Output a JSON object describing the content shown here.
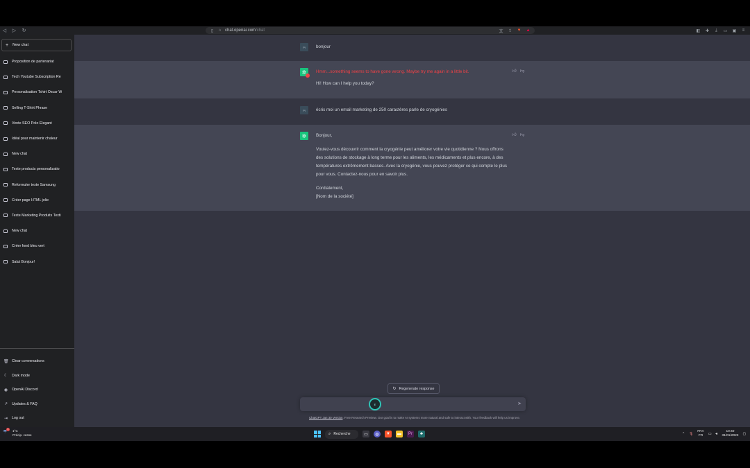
{
  "browser": {
    "url_host": "chat.openai.com",
    "url_path": "/chat"
  },
  "sidebar": {
    "new_chat_label": "New chat",
    "conversations": [
      "Proposition de partenariat",
      "Tech Youtube Subscription Re",
      "Personalisation Tshirt Oscar W",
      "Selling T-Shirt Phrase",
      "Vente SEO Polo Elegant",
      "Idéal pour maintenir chaleur",
      "New chat",
      "Texte products personalizatio",
      "Reformuler texte Samsung",
      "Créer page HTML jolie",
      "Texte Marketing Produits Texti",
      "New chat",
      "Créer fond bleu vert",
      "Salut Bonjour!"
    ],
    "actions": [
      {
        "label": "Clear conversations",
        "icon": "trash-icon"
      },
      {
        "label": "Dark mode",
        "icon": "moon-icon"
      },
      {
        "label": "OpenAI Discord",
        "icon": "discord-icon"
      },
      {
        "label": "Updates & FAQ",
        "icon": "external-link-icon"
      },
      {
        "label": "Log out",
        "icon": "logout-icon"
      }
    ]
  },
  "messages": [
    {
      "role": "user",
      "avatar": "Pl",
      "text": "bonjour"
    },
    {
      "role": "assistant",
      "error": "Hmm...something seems to have gone wrong. Maybe try me again in a little bit.",
      "text": "Hi! How can I help you today?"
    },
    {
      "role": "user",
      "avatar": "Pl",
      "text": "écris moi un email marketing de 250 caractères parle de cryogénies"
    },
    {
      "role": "assistant",
      "greeting": "Bonjour,",
      "body": "Voulez-vous découvrir comment la cryogénie peut améliorer votre vie quotidienne ? Nous offrons des solutions de stockage à long terme pour les aliments, les médicaments et plus encore, à des températures extrêmement basses. Avec la cryogénie, vous pouvez protéger ce qui compte le plus pour vous. Contactez-nous pour en savoir plus.",
      "closing": "Cordialement,",
      "signature": "[Nom de la société]"
    }
  ],
  "composer": {
    "regenerate_label": "Regenerate response",
    "cursor_label": "E"
  },
  "footer": {
    "version_link": "ChatGPT Jan 30 Version",
    "note": ". Free Research Preview. Our goal is to make AI systems more natural and safe to interact with. Your feedback will help us improve."
  },
  "taskbar": {
    "weather_badge": "1",
    "temperature": "1°C",
    "weather_desc": "Précip. cesse",
    "search_label": "Recherche",
    "lang_line1": "FRA",
    "lang_line2": "FR",
    "time": "10:40",
    "date": "31/01/2023"
  },
  "colors": {
    "sidebar_bg": "#202123",
    "user_bg": "#343541",
    "assistant_bg": "#444654",
    "accent_green": "#19c37d",
    "error_red": "#ef4146"
  }
}
